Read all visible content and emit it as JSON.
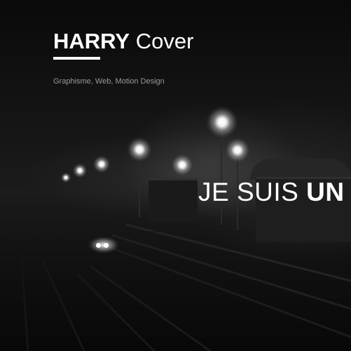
{
  "header": {
    "brand_strong": "HARRY",
    "brand_light": "Cover",
    "tagline": "Graphisme, Web, Motion Design"
  },
  "hero": {
    "headline_light": "JE SUIS",
    "headline_strong": "UN"
  },
  "colors": {
    "text": "#ffffff",
    "tagline": "#9a9a9a",
    "background": "#0b0b0b"
  }
}
